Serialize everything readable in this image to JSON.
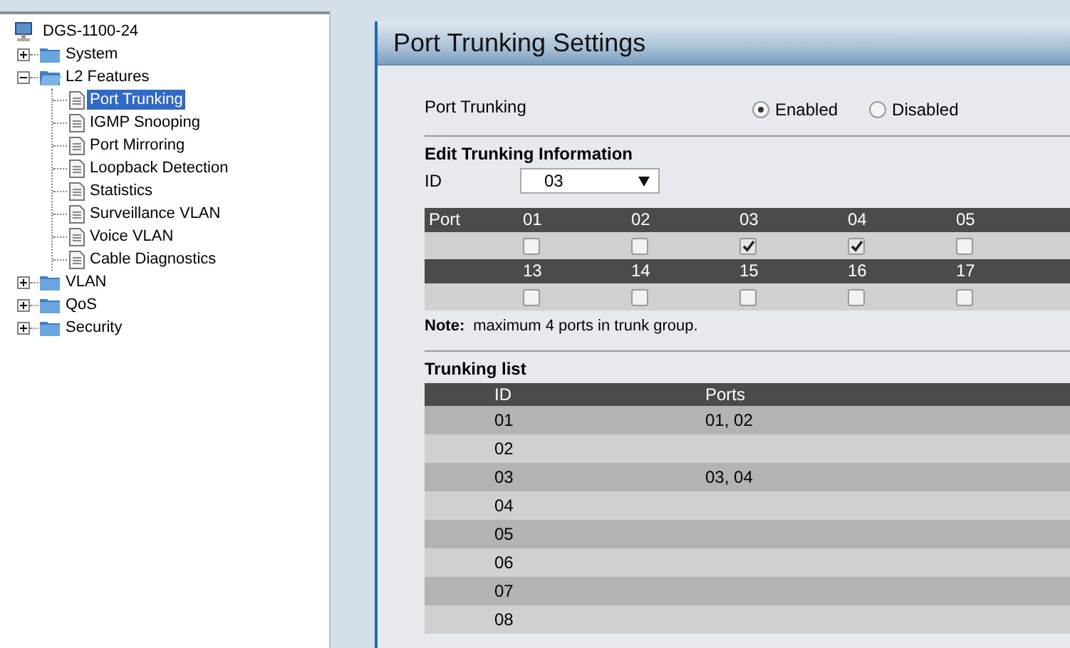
{
  "tree": {
    "label": "DGS-1100-24",
    "children": [
      {
        "label": "System",
        "kind": "folder",
        "expanded": false,
        "selected": false
      },
      {
        "label": "L2 Features",
        "kind": "folder",
        "expanded": true,
        "selected": false,
        "children": [
          {
            "label": "Port Trunking",
            "kind": "page",
            "selected": true
          },
          {
            "label": "IGMP Snooping",
            "kind": "page",
            "selected": false
          },
          {
            "label": "Port Mirroring",
            "kind": "page",
            "selected": false
          },
          {
            "label": "Loopback Detection",
            "kind": "page",
            "selected": false
          },
          {
            "label": "Statistics",
            "kind": "page",
            "selected": false
          },
          {
            "label": "Surveillance VLAN",
            "kind": "page",
            "selected": false
          },
          {
            "label": "Voice VLAN",
            "kind": "page",
            "selected": false
          },
          {
            "label": "Cable Diagnostics",
            "kind": "page",
            "selected": false
          }
        ]
      },
      {
        "label": "VLAN",
        "kind": "folder",
        "expanded": false,
        "selected": false
      },
      {
        "label": "QoS",
        "kind": "folder",
        "expanded": false,
        "selected": false
      },
      {
        "label": "Security",
        "kind": "folder",
        "expanded": false,
        "selected": false
      }
    ]
  },
  "page": {
    "title": "Port Trunking Settings",
    "port_trunking": {
      "label": "Port Trunking",
      "options": [
        {
          "label": "Enabled",
          "selected": true
        },
        {
          "label": "Disabled",
          "selected": false
        }
      ]
    },
    "edit": {
      "heading": "Edit Trunking Information",
      "id_label": "ID",
      "id_value": "03"
    },
    "port_grid": {
      "header_label": "Port",
      "groups": [
        {
          "ports": [
            {
              "label": "01",
              "checked": false
            },
            {
              "label": "02",
              "checked": false
            },
            {
              "label": "03",
              "checked": true
            },
            {
              "label": "04",
              "checked": true
            },
            {
              "label": "05",
              "checked": false
            }
          ]
        },
        {
          "ports": [
            {
              "label": "13",
              "checked": false
            },
            {
              "label": "14",
              "checked": false
            },
            {
              "label": "15",
              "checked": false
            },
            {
              "label": "16",
              "checked": false
            },
            {
              "label": "17",
              "checked": false
            }
          ]
        }
      ]
    },
    "note": {
      "label": "Note:",
      "text": "maximum 4 ports in trunk group."
    },
    "trunking_list": {
      "heading": "Trunking list",
      "columns": [
        "ID",
        "Ports"
      ],
      "rows": [
        {
          "id": "01",
          "ports": "01, 02"
        },
        {
          "id": "02"
        },
        {
          "id": "03",
          "ports": "03, 04"
        },
        {
          "id": "04"
        },
        {
          "id": "05"
        },
        {
          "id": "06"
        },
        {
          "id": "07"
        },
        {
          "id": "08"
        }
      ]
    }
  }
}
